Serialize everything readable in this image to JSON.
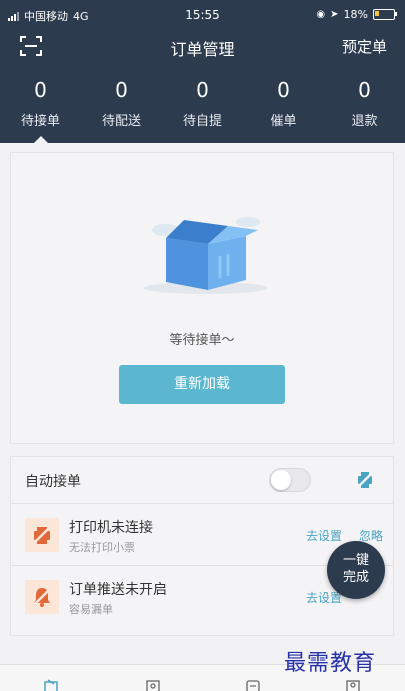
{
  "status": {
    "carrier": "中国移动",
    "network": "4G",
    "time": "15:55",
    "battery": "18%"
  },
  "header": {
    "title": "订单管理",
    "right_link": "预定单"
  },
  "tabs": [
    {
      "count": "0",
      "label": "待接单"
    },
    {
      "count": "0",
      "label": "待配送"
    },
    {
      "count": "0",
      "label": "待自提"
    },
    {
      "count": "0",
      "label": "催单"
    },
    {
      "count": "0",
      "label": "退款"
    }
  ],
  "empty": {
    "message": "等待接单～",
    "reload_label": "重新加载"
  },
  "auto_accept": {
    "label": "自动接单",
    "enabled": false
  },
  "printer": {
    "title": "打印机未连接",
    "subtitle": "无法打印小票",
    "setup_label": "去设置",
    "ignore_label": "忽略"
  },
  "push": {
    "title": "订单推送未开启",
    "subtitle": "容易漏单",
    "setup_label": "去设置"
  },
  "fab": {
    "line1": "一键",
    "line2": "完成"
  },
  "watermark": "最需教育",
  "colors": {
    "header_bg": "#2d3b4e",
    "accent": "#5ab7cf",
    "link": "#4aa3c2",
    "warn_icon_bg": "#fbe6d7",
    "warn_icon": "#e0683a"
  }
}
